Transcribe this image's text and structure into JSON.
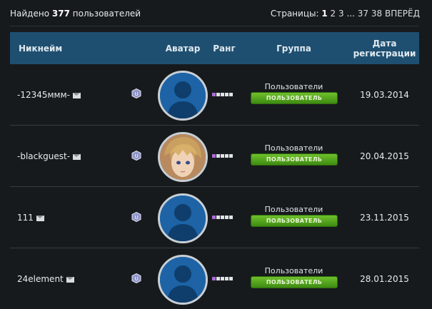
{
  "header": {
    "found_prefix": "Найдено",
    "found_count": "377",
    "found_suffix": "пользователей",
    "pages_label": "Страницы:",
    "pages": [
      "1",
      "2",
      "3",
      "...",
      "37",
      "38",
      "ВПЕРЁД"
    ]
  },
  "table": {
    "columns": {
      "nickname": "Никнейм",
      "avatar": "Аватар",
      "rank": "Ранг",
      "group": "Группа",
      "regdate_line1": "Дата",
      "regdate_line2": "регистрации"
    },
    "rows": [
      {
        "nickname": "-12345ммм-",
        "group": "Пользователи",
        "group_badge": "ПОЛЬЗОВАТЕЛЬ",
        "regdate": "19.03.2014",
        "avatar": "default-avatar"
      },
      {
        "nickname": "-blackguest-",
        "group": "Пользователи",
        "group_badge": "ПОЛЬЗОВАТЕЛЬ",
        "regdate": "20.04.2015",
        "avatar": "anime-character-avatar"
      },
      {
        "nickname": "111",
        "group": "Пользователи",
        "group_badge": "ПОЛЬЗОВАТЕЛЬ",
        "regdate": "23.11.2015",
        "avatar": "default-avatar"
      },
      {
        "nickname": "24element",
        "group": "Пользователи",
        "group_badge": "ПОЛЬЗОВАТЕЛЬ",
        "regdate": "28.01.2015",
        "avatar": "default-avatar"
      }
    ]
  },
  "colors": {
    "background": "#171a1d",
    "header_bar": "#1f4f70",
    "group_button": "#5aa91f",
    "rank_first": "#b06ad8",
    "avatar_bg": "#1d5f9c"
  },
  "icons": {
    "mail": "mail-icon",
    "status": "shield-status-icon"
  }
}
